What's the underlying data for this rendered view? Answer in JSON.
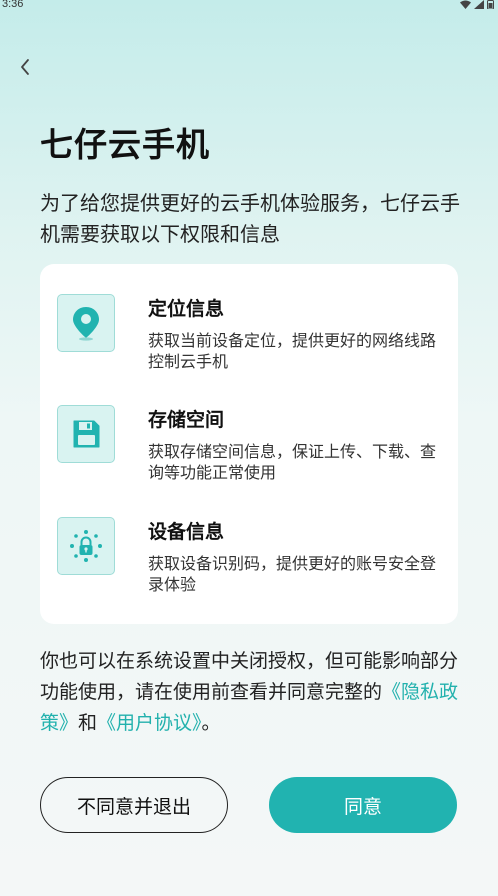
{
  "status_bar": {
    "time": "3:36"
  },
  "header": {
    "title": "七仔云手机"
  },
  "intro": {
    "text": "为了给您提供更好的云手机体验服务，七仔云手机需要获取以下权限和信息"
  },
  "permissions": [
    {
      "icon": "location-pin-icon",
      "title": "定位信息",
      "desc": "获取当前设备定位，提供更好的网络线路控制云手机"
    },
    {
      "icon": "floppy-disk-icon",
      "title": "存储空间",
      "desc": "获取存储空间信息，保证上传、下载、查询等功能正常使用"
    },
    {
      "icon": "device-lock-icon",
      "title": "设备信息",
      "desc": "获取设备识别码，提供更好的账号安全登录体验"
    }
  ],
  "footer": {
    "text_before": "你也可以在系统设置中关闭授权，但可能影响部分功能使用，请在使用前查看并同意完整的",
    "privacy_link": "《隐私政策》",
    "and": "和",
    "agreement_link": "《用户协议》",
    "text_after": "。"
  },
  "buttons": {
    "disagree": "不同意并退出",
    "agree": "同意"
  },
  "colors": {
    "accent": "#21b3b0",
    "link": "#22b1ad",
    "icon_bg": "#d9f3f1"
  }
}
